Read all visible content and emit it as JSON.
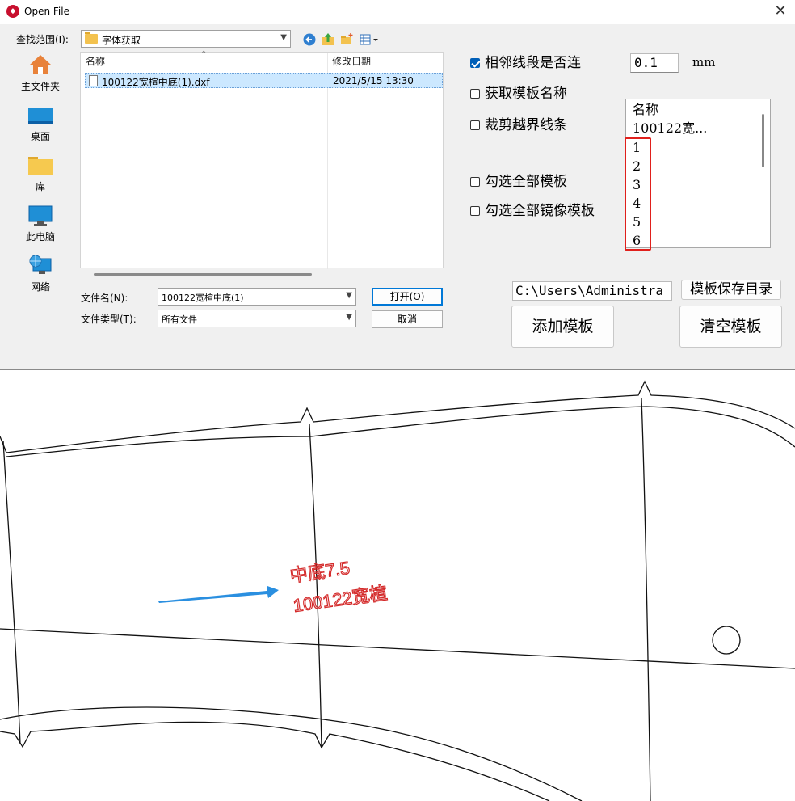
{
  "window": {
    "title": "Open File",
    "close_glyph": "✕"
  },
  "lookin": {
    "label": "查找范围(I):",
    "value": "字体获取"
  },
  "places": [
    {
      "label": "主文件夹",
      "icon": "home-icon"
    },
    {
      "label": "桌面",
      "icon": "desktop-icon"
    },
    {
      "label": "库",
      "icon": "library-folder-icon"
    },
    {
      "label": "此电脑",
      "icon": "computer-icon"
    },
    {
      "label": "网络",
      "icon": "network-icon"
    }
  ],
  "filelist": {
    "col_name": "名称",
    "col_date": "修改日期",
    "rows": [
      {
        "name": "100122宽楦中底(1).dxf",
        "date": "2021/5/15 13:30"
      }
    ]
  },
  "filename": {
    "label": "文件名(N):",
    "value": "100122宽楦中底(1)"
  },
  "filetype": {
    "label": "文件类型(T):",
    "value": "所有文件"
  },
  "buttons": {
    "open": "打开(O)",
    "cancel": "取消",
    "add_template": "添加模板",
    "clear_template": "清空模板",
    "template_dir": "模板保存目录"
  },
  "options": {
    "connect_adjacent": {
      "label": "相邻线段是否连",
      "checked": true
    },
    "get_template_name": {
      "label": "获取模板名称",
      "checked": false
    },
    "clip_out_of_bounds": {
      "label": "裁剪越界线条",
      "checked": false
    },
    "select_all_templates": {
      "label": "勾选全部模板",
      "checked": false
    },
    "select_all_mirror": {
      "label": "勾选全部镜像模板",
      "checked": false
    }
  },
  "spacing": {
    "value": "0.1",
    "unit": "mm"
  },
  "template_list": {
    "header": "名称",
    "items": [
      "100122宽...",
      "1",
      "2",
      "3",
      "4",
      "5",
      "6"
    ]
  },
  "path": {
    "value": "C:\\Users\\Administra"
  },
  "cad_annotation": {
    "line1": "中底7.5",
    "line2": "100122宽楦",
    "text_color": "#d42a2a",
    "arrow_color": "#2a8fe0"
  }
}
